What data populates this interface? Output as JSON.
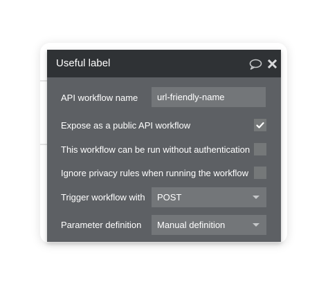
{
  "panel": {
    "title": "Useful label",
    "header_icons": [
      "comment-icon",
      "close-icon"
    ]
  },
  "fields": {
    "api_workflow_name": {
      "label": "API workflow name",
      "value": "url-friendly-name"
    },
    "expose_public": {
      "label": "Expose as a public API workflow",
      "checked": true
    },
    "no_auth": {
      "label": "This workflow can be run without authentication",
      "checked": false
    },
    "ignore_privacy": {
      "label": "Ignore privacy rules when running the workflow",
      "checked": false
    },
    "trigger_with": {
      "label": "Trigger workflow with",
      "selected": "POST"
    },
    "parameter_definition": {
      "label": "Parameter definition",
      "selected": "Manual definition"
    }
  },
  "colors": {
    "header_bg": "#2f3235",
    "panel_bg": "#5d6064",
    "field_bg": "#737679"
  }
}
